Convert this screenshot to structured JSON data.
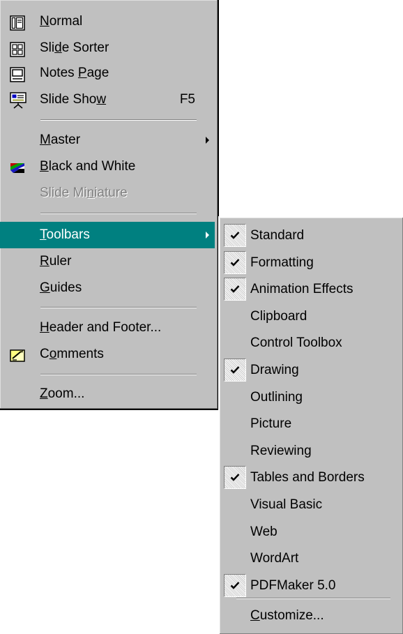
{
  "view_menu": {
    "items": [
      {
        "pre": "",
        "key": "N",
        "post": "ormal",
        "shortcut": "",
        "icon": "normal-view-icon"
      },
      {
        "pre": "Sli",
        "key": "d",
        "post": "e Sorter",
        "shortcut": "",
        "icon": "slide-sorter-icon"
      },
      {
        "pre": "Notes ",
        "key": "P",
        "post": "age",
        "shortcut": "",
        "icon": "notes-page-icon"
      },
      {
        "pre": "Slide Sho",
        "key": "w",
        "post": "",
        "shortcut": "F5",
        "icon": "slide-show-icon"
      },
      {
        "pre": "",
        "key": "M",
        "post": "aster",
        "shortcut": "",
        "icon": ""
      },
      {
        "pre": "",
        "key": "B",
        "post": "lack and White",
        "shortcut": "",
        "icon": "black-and-white-icon"
      },
      {
        "pre": "Slide Mi",
        "key": "n",
        "post": "iature",
        "shortcut": "",
        "icon": ""
      },
      {
        "pre": "",
        "key": "T",
        "post": "oolbars",
        "shortcut": "",
        "icon": ""
      },
      {
        "pre": "",
        "key": "R",
        "post": "uler",
        "shortcut": "",
        "icon": ""
      },
      {
        "pre": "",
        "key": "G",
        "post": "uides",
        "shortcut": "",
        "icon": ""
      },
      {
        "pre": "",
        "key": "H",
        "post": "eader and Footer...",
        "shortcut": "",
        "icon": ""
      },
      {
        "pre": "C",
        "key": "o",
        "post": "mments",
        "shortcut": "",
        "icon": "comments-icon"
      },
      {
        "pre": "",
        "key": "Z",
        "post": "oom...",
        "shortcut": "",
        "icon": ""
      }
    ]
  },
  "toolbars_submenu": {
    "items": [
      {
        "label": "Standard",
        "checked": true
      },
      {
        "label": "Formatting",
        "checked": true
      },
      {
        "label": "Animation Effects",
        "checked": true
      },
      {
        "label": "Clipboard",
        "checked": false
      },
      {
        "label": "Control Toolbox",
        "checked": false
      },
      {
        "label": "Drawing",
        "checked": true
      },
      {
        "label": "Outlining",
        "checked": false
      },
      {
        "label": "Picture",
        "checked": false
      },
      {
        "label": "Reviewing",
        "checked": false
      },
      {
        "label": "Tables and Borders",
        "checked": true
      },
      {
        "label": "Visual Basic",
        "checked": false
      },
      {
        "label": "Web",
        "checked": false
      },
      {
        "label": "WordArt",
        "checked": false
      },
      {
        "label": "PDFMaker 5.0",
        "checked": true
      }
    ],
    "customize": {
      "pre": "",
      "key": "C",
      "post": "ustomize..."
    }
  },
  "colors": {
    "menu_face": "#c0c0c0",
    "highlight": "#008080",
    "highlight_text": "#ffffff",
    "disabled_text": "#808080"
  }
}
